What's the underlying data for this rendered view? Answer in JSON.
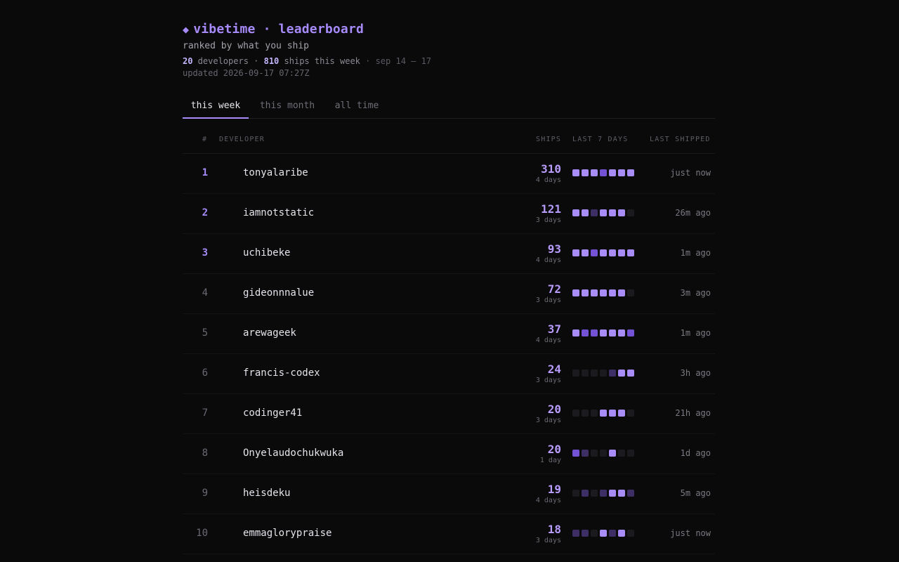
{
  "header": {
    "brand_icon": "◆",
    "title": "vibetime · leaderboard",
    "tagline": "ranked by what you ship",
    "developers_count": "20",
    "developers_label": " developers · ",
    "ships_count": "810",
    "ships_label": " ships this week",
    "date_range": " · sep 14 — 17",
    "updated": "updated 2026-09-17 07:27Z"
  },
  "tabs": [
    {
      "label": "this week",
      "active": true
    },
    {
      "label": "this month",
      "active": false
    },
    {
      "label": "all time",
      "active": false
    }
  ],
  "table": {
    "headers": {
      "rank": "#",
      "developer": "DEVELOPER",
      "ships": "SHIPS",
      "last7": "LAST 7 DAYS",
      "last_shipped": "LAST SHIPPED"
    },
    "rows": [
      {
        "rank": "1",
        "name": "tonyalaribe",
        "ships": "310",
        "days": "4 days",
        "activity": [
          3,
          3,
          3,
          2,
          3,
          3,
          3
        ],
        "last": "just now"
      },
      {
        "rank": "2",
        "name": "iamnotstatic",
        "ships": "121",
        "days": "3 days",
        "activity": [
          3,
          3,
          1,
          3,
          3,
          3,
          0
        ],
        "last": "26m ago"
      },
      {
        "rank": "3",
        "name": "uchibeke",
        "ships": "93",
        "days": "4 days",
        "activity": [
          3,
          3,
          2,
          3,
          3,
          3,
          3
        ],
        "last": "1m ago"
      },
      {
        "rank": "4",
        "name": "gideonnnalue",
        "ships": "72",
        "days": "3 days",
        "activity": [
          3,
          3,
          3,
          3,
          3,
          3,
          0
        ],
        "last": "3m ago"
      },
      {
        "rank": "5",
        "name": "arewageek",
        "ships": "37",
        "days": "4 days",
        "activity": [
          3,
          2,
          2,
          3,
          3,
          3,
          2
        ],
        "last": "1m ago"
      },
      {
        "rank": "6",
        "name": "francis-codex",
        "ships": "24",
        "days": "3 days",
        "activity": [
          0,
          0,
          0,
          0,
          1,
          3,
          3
        ],
        "last": "3h ago"
      },
      {
        "rank": "7",
        "name": "codinger41",
        "ships": "20",
        "days": "3 days",
        "activity": [
          0,
          0,
          0,
          3,
          3,
          3,
          0
        ],
        "last": "21h ago"
      },
      {
        "rank": "8",
        "name": "Onyelaudochukwuka",
        "ships": "20",
        "days": "1 day",
        "activity": [
          2,
          1,
          0,
          0,
          3,
          0,
          0
        ],
        "last": "1d ago"
      },
      {
        "rank": "9",
        "name": "heisdeku",
        "ships": "19",
        "days": "4 days",
        "activity": [
          0,
          1,
          0,
          1,
          3,
          3,
          1
        ],
        "last": "5m ago"
      },
      {
        "rank": "10",
        "name": "emmaglorypraise",
        "ships": "18",
        "days": "3 days",
        "activity": [
          1,
          1,
          0,
          3,
          1,
          3,
          0
        ],
        "last": "just now"
      }
    ]
  },
  "colors": {
    "accent": "#a78bfa",
    "level0": "#1b1b1f",
    "level1": "#3d2f66",
    "level2": "#7452d6",
    "level3": "#a88cf7"
  }
}
